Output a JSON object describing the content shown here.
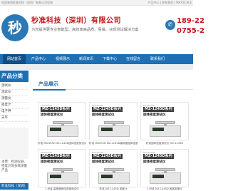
{
  "topbar": {
    "left": "欢迎来到秒准科技（深圳）有限公司官网",
    "right": "产品中心 | 联系我们 | MAXSCALE"
  },
  "header": {
    "logo_text": "秒",
    "company_name": "秒准科技（深圳）有限公司",
    "slogan": "为您提供更专业智能型、高效率高品质、易操、决现测试解决方案",
    "phone1": "189-22",
    "phone2": "0755-2"
  },
  "nav": {
    "items": [
      "网站首页",
      "产品中心",
      "视频展示",
      "新闻资讯",
      "下载中心",
      "在线留言",
      "联系我们"
    ],
    "active_index": 0
  },
  "sidebar": {
    "title": "产品分类",
    "items": [
      "测试仪",
      "测试仪",
      "测量仪",
      "密度计",
      "电子秤",
      "天平"
    ],
    "contact_text": "主营：检测仪器、密度计等多款测量产品",
    "footer": "秒准科技（深圳）"
  },
  "main": {
    "title": "产品展示",
    "cards": [
      {
        "brand": "MAXSCALE",
        "model": "MZ-1245D系列",
        "name": "固体密度测试仪",
        "caption": "秒准 MAYZUN MZ-1245D固体密度测试仪"
      },
      {
        "brand": "MAXSCALE",
        "model": "MZ-1245D系列",
        "name": "固体密度测试仪",
        "caption": "秒准 MAYZUN MZ-1245D高精度固体密度仪"
      },
      {
        "brand": "MAXSCALE",
        "model": "MZ-1245D系列",
        "name": "固体密度测试仪",
        "caption": "秒准固体密度测试仪 MZ-1245D"
      },
      {
        "brand": "MAXSCALE",
        "model": "MZ-1245D系列",
        "name": "固体密度测试仪",
        "caption": "1 秒准 高精度固体密度测试仪"
      },
      {
        "brand": "MAXSCALE",
        "model": "MZ-1245D系列",
        "name": "固体密度测试仪",
        "caption": "秒准 MZ-1245D 密度计"
      },
      {
        "brand": "MAXSCALE",
        "model": "MZ-1245D系列",
        "name": "固体密度测试仪",
        "caption": "1 秒准 MZ-1245D 固体密度仪"
      }
    ]
  },
  "colors": {
    "brand_blue": "#1e6fb3",
    "brand_red": "#c4161c"
  }
}
